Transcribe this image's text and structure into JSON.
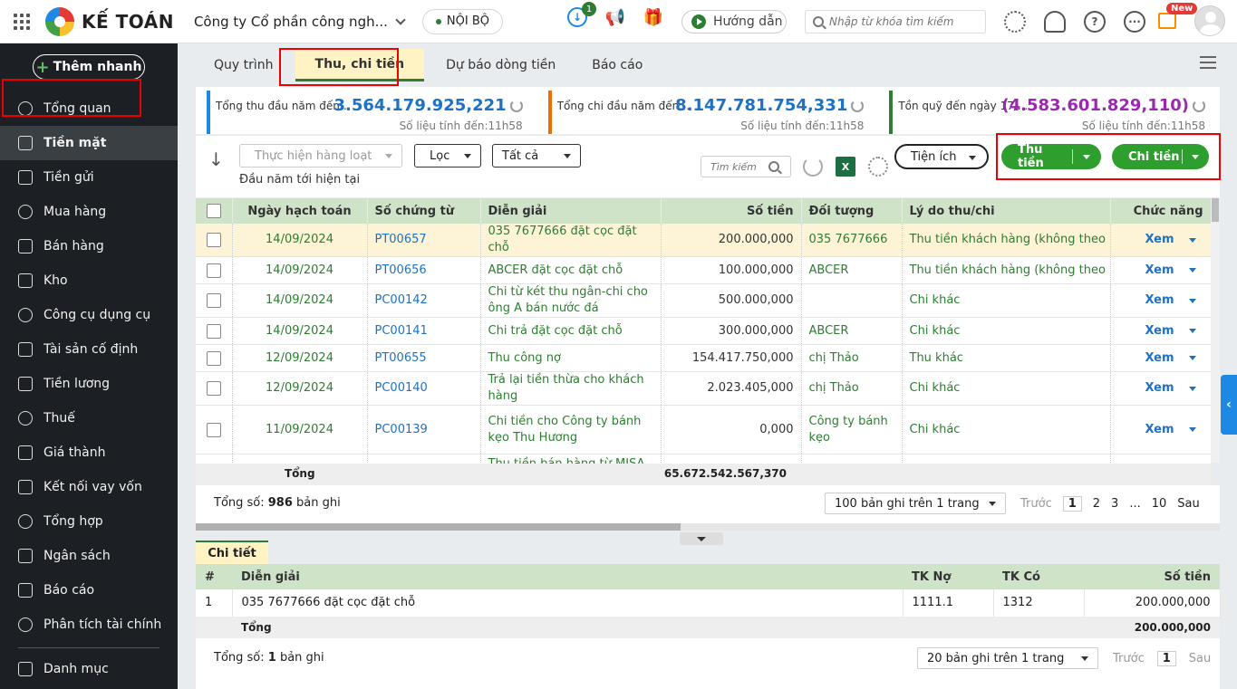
{
  "header": {
    "logo_text": "KẾ TOÁN",
    "company": "Công ty Cổ phần công ngh...",
    "environment": "NỘI BỘ",
    "download_badge": "1",
    "guide_label": "Hướng dẫn",
    "search_placeholder": "Nhập từ khóa tìm kiếm",
    "new_badge": "New"
  },
  "sidebar": {
    "quick_add": "Thêm nhanh",
    "items": [
      {
        "label": "Tổng quan",
        "icon": "dashboard-icon"
      },
      {
        "label": "Tiền mặt",
        "icon": "cash-bag-icon",
        "active": true
      },
      {
        "label": "Tiền gửi",
        "icon": "bank-icon"
      },
      {
        "label": "Mua hàng",
        "icon": "shopping-bag-icon"
      },
      {
        "label": "Bán hàng",
        "icon": "cart-icon"
      },
      {
        "label": "Kho",
        "icon": "warehouse-icon"
      },
      {
        "label": "Công cụ dụng cụ",
        "icon": "tools-icon"
      },
      {
        "label": "Tài sản cố định",
        "icon": "car-icon"
      },
      {
        "label": "Tiền lương",
        "icon": "payroll-icon"
      },
      {
        "label": "Thuế",
        "icon": "tax-icon"
      },
      {
        "label": "Giá thành",
        "icon": "price-tag-icon"
      },
      {
        "label": "Kết nối vay vốn",
        "icon": "loan-icon"
      },
      {
        "label": "Tổng hợp",
        "icon": "summary-icon"
      },
      {
        "label": "Ngân sách",
        "icon": "budget-icon"
      },
      {
        "label": "Báo cáo",
        "icon": "report-icon"
      },
      {
        "label": "Phân tích tài chính",
        "icon": "analysis-icon"
      }
    ],
    "bottom_item": "Danh mục"
  },
  "tabs": [
    "Quy trình",
    "Thu, chi tiền",
    "Dự báo dòng tiền",
    "Báo cáo"
  ],
  "cards": [
    {
      "label": "Tổng thu đầu năm đến ...",
      "value": "3.564.179.925,221",
      "time": "Số liệu tính đến:11h58"
    },
    {
      "label": "Tổng chi đầu năm đến hi...",
      "value": "8.147.781.754,331",
      "time": "Số liệu tính đến:11h58"
    },
    {
      "label": "Tồn quỹ đến ngày 17/...",
      "value": "(4.583.601.829,110)",
      "time": "Số liệu tính đến:11h58"
    }
  ],
  "toolbar": {
    "bulk_action": "Thực hiện hàng loạt",
    "filter": "Lọc",
    "scope": "Tất cả",
    "period": "Đầu năm tới hiện tại",
    "search_placeholder": "Tìm kiếm",
    "utilities": "Tiện ích",
    "receive": "Thu tiền",
    "pay": "Chi tiền",
    "excel_icon_text": "X"
  },
  "table": {
    "columns": [
      "Ngày hạch toán",
      "Số chứng từ",
      "Diễn giải",
      "Số tiền",
      "Đối tượng",
      "Lý do thu/chi",
      "Chức năng"
    ],
    "rows": [
      {
        "date": "14/09/2024",
        "doc": "PT00657",
        "desc": "035 7677666 đặt cọc đặt chỗ",
        "amount": "200.000,000",
        "obj": "035 7677666",
        "reason": "Thu tiền khách hàng (không theo hóa",
        "action": "Xem"
      },
      {
        "date": "14/09/2024",
        "doc": "PT00656",
        "desc": "ABCER đặt cọc đặt chỗ",
        "amount": "100.000,000",
        "obj": "ABCER",
        "reason": "Thu tiền khách hàng (không theo hóa",
        "action": "Xem"
      },
      {
        "date": "14/09/2024",
        "doc": "PC00142",
        "desc": "Chi từ két thu ngân-chi cho ông A bán nước đá",
        "amount": "500.000,000",
        "obj": "",
        "reason": "Chi khác",
        "action": "Xem"
      },
      {
        "date": "14/09/2024",
        "doc": "PC00141",
        "desc": "Chi trả đặt cọc đặt chỗ",
        "amount": "300.000,000",
        "obj": "ABCER",
        "reason": "Chi khác",
        "action": "Xem"
      },
      {
        "date": "12/09/2024",
        "doc": "PT00655",
        "desc": "Thu công nợ",
        "amount": "154.417.750,000",
        "obj": "chị Thảo",
        "reason": "Thu khác",
        "action": "Xem"
      },
      {
        "date": "12/09/2024",
        "doc": "PC00140",
        "desc": "Trả lại tiền thừa cho khách hàng",
        "amount": "2.023.405,000",
        "obj": "chị Thảo",
        "reason": "Chi khác",
        "action": "Xem"
      },
      {
        "date": "11/09/2024",
        "doc": "PC00139",
        "desc": "Chi tiền cho Công ty bánh kẹo Thu Hương",
        "amount": "0,000",
        "obj": "Công ty bánh kẹo",
        "reason": "Chi khác",
        "action": "Xem"
      },
      {
        "date": "",
        "doc": "",
        "desc": "Thu tiền bán hàng từ MISA",
        "amount": "",
        "obj": "",
        "reason": "",
        "action": ""
      }
    ],
    "total_label": "Tổng",
    "total_value": "65.672.542.567,370"
  },
  "pager": {
    "count_prefix": "Tổng số:",
    "count": "986",
    "count_suffix": "bản ghi",
    "page_size": "100 bản ghi trên 1 trang",
    "prev": "Trước",
    "pages": [
      "1",
      "2",
      "3",
      "...",
      "10"
    ],
    "next": "Sau"
  },
  "detail": {
    "tab": "Chi tiết",
    "columns": [
      "#",
      "Diễn giải",
      "TK Nợ",
      "TK Có",
      "Số tiền"
    ],
    "rows": [
      {
        "idx": "1",
        "desc": "035 7677666 đặt cọc đặt chỗ",
        "debit": "1111.1",
        "credit": "1312",
        "amount": "200.000,000"
      }
    ],
    "total_label": "Tổng",
    "total_value": "200.000,000",
    "count_prefix": "Tổng số:",
    "count": "1",
    "count_suffix": "bản ghi",
    "page_size": "20 bản ghi trên 1 trang",
    "prev": "Trước",
    "page": "1",
    "next": "Sau"
  },
  "colors": {
    "accent_green": "#2e9e2e",
    "link_blue": "#1e72c4",
    "highlight_red": "#e00000"
  }
}
